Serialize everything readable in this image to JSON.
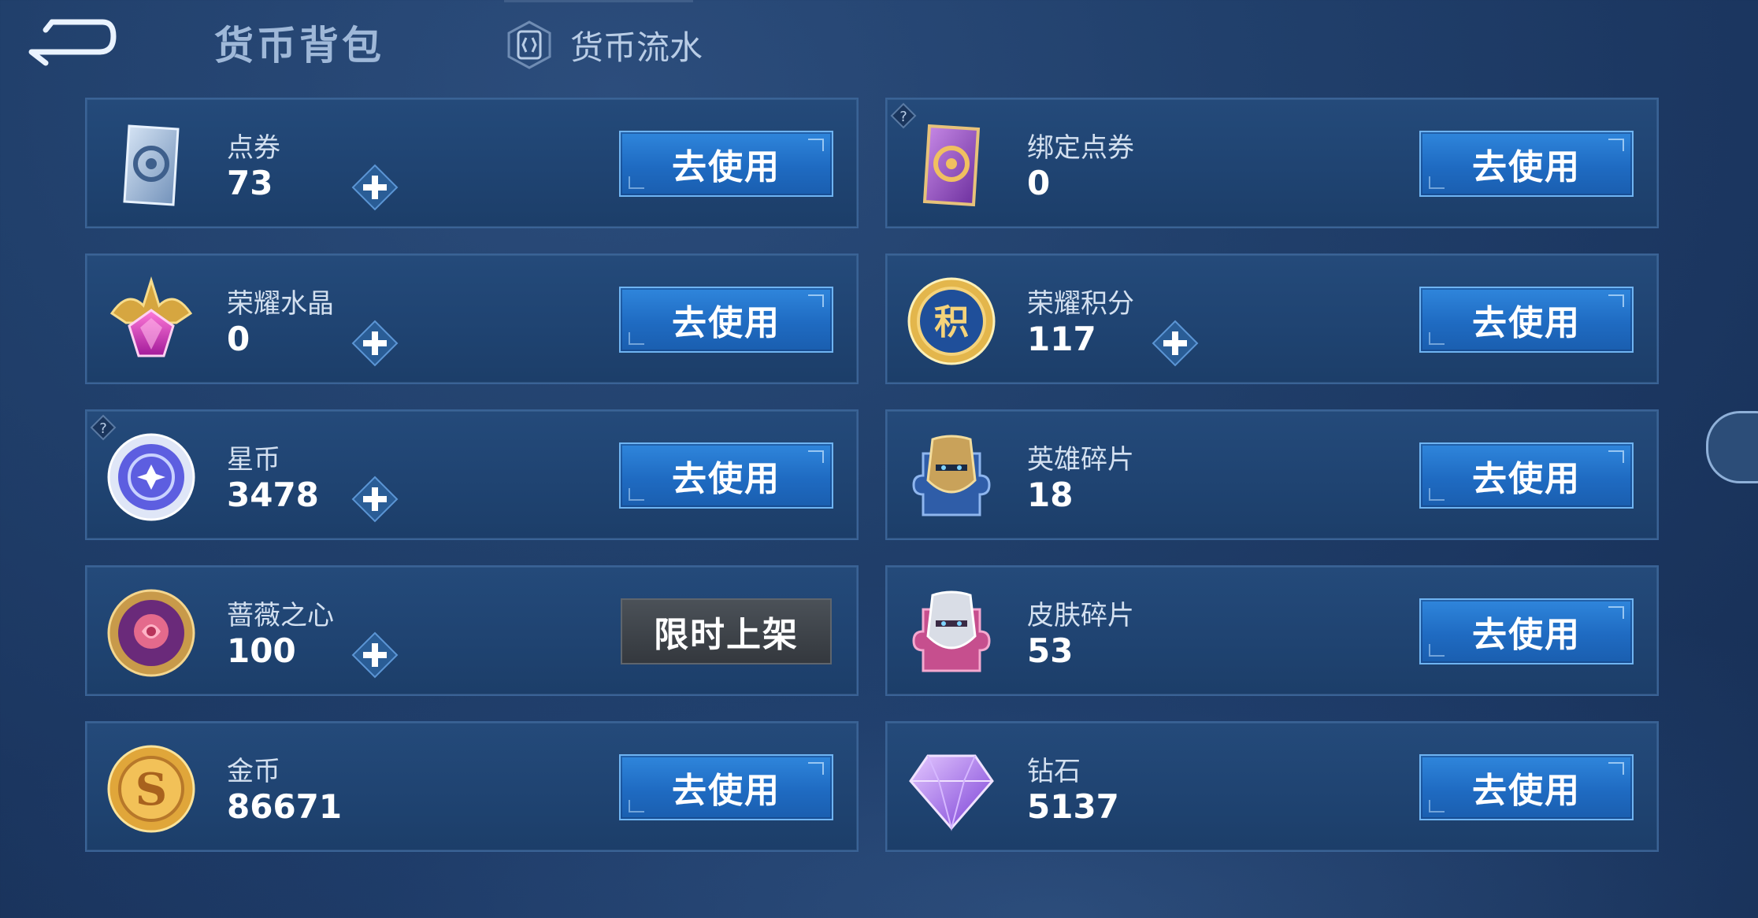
{
  "header": {
    "title": "货币背包",
    "flow_link_label": "货币流水"
  },
  "colors": {
    "use_button": "#1f6bc2",
    "limited_button": "#3d4248",
    "card_bg": "#21446f"
  },
  "currencies": [
    {
      "name": "点券",
      "value": "73",
      "icon": "coupon-icon",
      "has_plus": true,
      "action": "去使用"
    },
    {
      "name": "绑定点券",
      "value": "0",
      "icon": "bound-coupon-icon",
      "has_plus": false,
      "has_help": true,
      "action": "去使用"
    },
    {
      "name": "荣耀水晶",
      "value": "0",
      "icon": "glory-crystal-icon",
      "has_plus": true,
      "action": "去使用"
    },
    {
      "name": "荣耀积分",
      "value": "117",
      "icon": "glory-points-icon",
      "has_plus": true,
      "action": "去使用"
    },
    {
      "name": "星币",
      "value": "3478",
      "icon": "star-coin-icon",
      "has_plus": true,
      "has_help": true,
      "action": "去使用"
    },
    {
      "name": "英雄碎片",
      "value": "18",
      "icon": "hero-fragment-icon",
      "has_plus": false,
      "action": "去使用"
    },
    {
      "name": "蔷薇之心",
      "value": "100",
      "icon": "rose-heart-icon",
      "has_plus": true,
      "action": "限时上架"
    },
    {
      "name": "皮肤碎片",
      "value": "53",
      "icon": "skin-fragment-icon",
      "has_plus": false,
      "action": "去使用"
    },
    {
      "name": "金币",
      "value": "86671",
      "icon": "gold-coin-icon",
      "has_plus": false,
      "action": "去使用"
    },
    {
      "name": "钻石",
      "value": "5137",
      "icon": "diamond-icon",
      "has_plus": false,
      "action": "去使用"
    }
  ]
}
